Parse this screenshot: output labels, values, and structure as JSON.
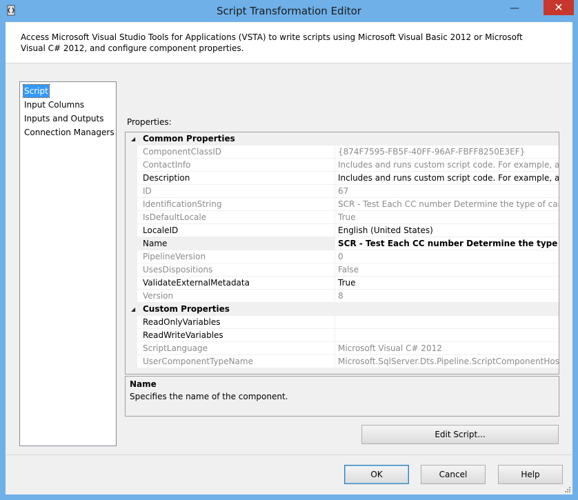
{
  "window": {
    "title": "Script Transformation Editor",
    "close_glyph": "✕",
    "minimize_glyph": "—"
  },
  "header": {
    "description": "Access Microsoft Visual Studio Tools for Applications (VSTA) to write scripts using Microsoft Visual Basic 2012 or Microsoft Visual C# 2012, and configure component properties."
  },
  "sidebar": {
    "items": [
      {
        "label": "Script",
        "selected": true
      },
      {
        "label": "Input Columns"
      },
      {
        "label": "Inputs and Outputs"
      },
      {
        "label": "Connection Managers"
      }
    ]
  },
  "properties": {
    "label": "Properties:",
    "categories": [
      {
        "name": "Common Properties",
        "items": [
          {
            "name": "ComponentClassID",
            "value": "{874F7595-FB5F-40FF-96AF-FBFF8250E3EF}"
          },
          {
            "name": "ContactInfo",
            "value": "Includes and runs custom script code. For example, apply a b"
          },
          {
            "name": "Description",
            "value": "Includes and runs custom script code. For example, apply a b"
          },
          {
            "name": "ID",
            "value": "67"
          },
          {
            "name": "IdentificationString",
            "value": "SCR - Test Each CC number Determine the type of card and i"
          },
          {
            "name": "IsDefaultLocale",
            "value": "True"
          },
          {
            "name": "LocaleID",
            "value": "English (United States)"
          },
          {
            "name": "Name",
            "value": "SCR - Test Each CC number Determine the type of card an"
          },
          {
            "name": "PipelineVersion",
            "value": "0"
          },
          {
            "name": "UsesDispositions",
            "value": "False"
          },
          {
            "name": "ValidateExternalMetadata",
            "value": "True"
          },
          {
            "name": "Version",
            "value": "8"
          }
        ]
      },
      {
        "name": "Custom Properties",
        "items": [
          {
            "name": "ReadOnlyVariables",
            "value": ""
          },
          {
            "name": "ReadWriteVariables",
            "value": ""
          },
          {
            "name": "ScriptLanguage",
            "value": "Microsoft Visual C# 2012"
          },
          {
            "name": "UserComponentTypeName",
            "value": "Microsoft.SqlServer.Dts.Pipeline.ScriptComponentHost, Micr"
          }
        ]
      }
    ]
  },
  "description_panel": {
    "title": "Name",
    "text": "Specifies the name of the component."
  },
  "buttons": {
    "edit_script": "Edit Script...",
    "ok": "OK",
    "cancel": "Cancel",
    "help": "Help"
  }
}
